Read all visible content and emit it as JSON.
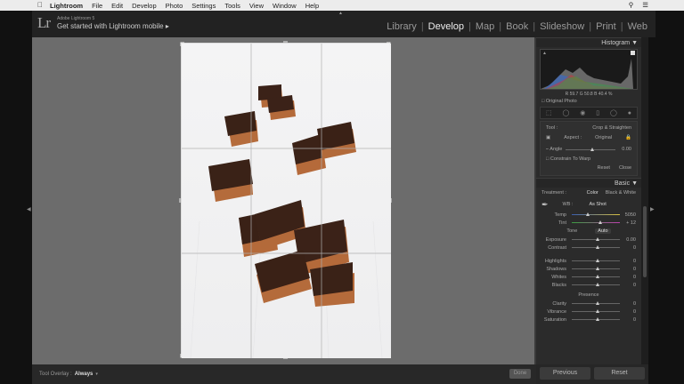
{
  "menubar": {
    "app": "Lightroom",
    "items": [
      "File",
      "Edit",
      "Develop",
      "Photo",
      "Settings",
      "Tools",
      "View",
      "Window",
      "Help"
    ]
  },
  "identity": {
    "product": "Adobe Lightroom 5",
    "tagline": "Get started with Lightroom mobile",
    "arrow": "▸"
  },
  "modules": [
    "Library",
    "Develop",
    "Map",
    "Book",
    "Slideshow",
    "Print",
    "Web"
  ],
  "active_module": "Develop",
  "toolbar": {
    "overlay_label": "Tool Overlay :",
    "overlay_value": "Always",
    "done": "Done"
  },
  "histogram": {
    "title": "Histogram",
    "r_label": "R",
    "r": "59.7",
    "g_label": "G",
    "g": "50.8",
    "b_label": "B",
    "b": "40.4",
    "pct": "%",
    "original": "Original Photo"
  },
  "crop": {
    "tool_label": "Tool :",
    "tool_value": "Crop & Straighten",
    "aspect_label": "Aspect :",
    "aspect_value": "Original",
    "angle_label": "Angle",
    "angle_value": "0.00",
    "constrain": "Constrain To Warp",
    "reset": "Reset",
    "close": "Close"
  },
  "basic": {
    "title": "Basic",
    "treatment_label": "Treatment :",
    "color": "Color",
    "bw": "Black & White",
    "wb_label": "WB :",
    "wb_value": "As Shot",
    "tone_label": "Tone",
    "auto": "Auto",
    "presence_label": "Presence",
    "sliders": [
      {
        "label": "Temp",
        "value": "5050",
        "pos": 0.3
      },
      {
        "label": "Tint",
        "value": "+ 12",
        "pos": 0.55
      },
      {
        "label": "Exposure",
        "value": "0.00",
        "pos": 0.5
      },
      {
        "label": "Contrast",
        "value": "0",
        "pos": 0.5
      },
      {
        "label": "Highlights",
        "value": "0",
        "pos": 0.5
      },
      {
        "label": "Shadows",
        "value": "0",
        "pos": 0.5
      },
      {
        "label": "Whites",
        "value": "0",
        "pos": 0.5
      },
      {
        "label": "Blacks",
        "value": "0",
        "pos": 0.5
      },
      {
        "label": "Clarity",
        "value": "0",
        "pos": 0.5
      },
      {
        "label": "Vibrance",
        "value": "0",
        "pos": 0.5
      },
      {
        "label": "Saturation",
        "value": "0",
        "pos": 0.5
      }
    ]
  },
  "bottom": {
    "previous": "Previous",
    "reset": "Reset"
  },
  "colors": {
    "accent": "#cfcfcf",
    "panel": "#2b2b2b",
    "workarea": "#6c6c6c"
  }
}
